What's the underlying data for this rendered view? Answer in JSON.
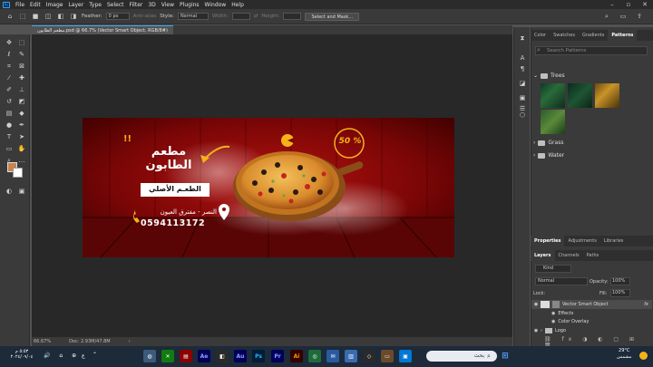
{
  "menu": [
    "File",
    "Edit",
    "Image",
    "Layer",
    "Type",
    "Select",
    "Filter",
    "3D",
    "View",
    "Plugins",
    "Window",
    "Help"
  ],
  "options": {
    "feather_label": "Feather:",
    "feather_value": "0 px",
    "antialias_label": "Anti-alias",
    "style_label": "Style:",
    "style_value": "Normal",
    "width_label": "Width:",
    "height_label": "Height:",
    "select_mask": "Select and Mask..."
  },
  "doc_tab": "مطعم الطابون.psd @ 66.7% (Vector Smart Object, RGB/8#)",
  "status": {
    "zoom": "66.67%",
    "doc": "Doc: 2.93M/47.8M"
  },
  "artwork": {
    "title": "مطعم الطابون",
    "exclaim": "!!",
    "subtitle": "الطعـم الأصلي",
    "address": "النصر - مفترق العيون",
    "phone": "0594113172",
    "badge": "50 %"
  },
  "right_panel": {
    "top_tabs": [
      "Color",
      "Swatches",
      "Gradients",
      "Patterns"
    ],
    "search_placeholder": "Search Patterns",
    "folders": [
      "Trees",
      "Grass",
      "Water"
    ],
    "mid_tabs": [
      "Properties",
      "Adjustments",
      "Libraries"
    ],
    "layer_tabs": [
      "Layers",
      "Channels",
      "Paths"
    ],
    "kind_value": "Kind",
    "blend_value": "Normal",
    "opacity_label": "Opacity:",
    "opacity_value": "100%",
    "lock_label": "Lock:",
    "fill_label": "Fill:",
    "fill_value": "100%",
    "layers": [
      {
        "name": "Vector Smart Object",
        "fx": "fx"
      },
      {
        "name": "Effects"
      },
      {
        "name": "Color Overlay"
      },
      {
        "name": "Logo"
      }
    ]
  },
  "taskbar": {
    "time": "٥:٥٣ م",
    "date": "٢٠٢٤/٠٩/٠٤",
    "lang": "ع",
    "search": "بحث",
    "weather_temp": "29°C",
    "weather_desc": "مشمس",
    "apps": [
      "Ae",
      "Au",
      "Ps",
      "Pr",
      "Ai"
    ]
  },
  "colors": {
    "accent": "#31a8ff",
    "brand_red": "#8b0000",
    "cheese": "#f5b21a"
  }
}
